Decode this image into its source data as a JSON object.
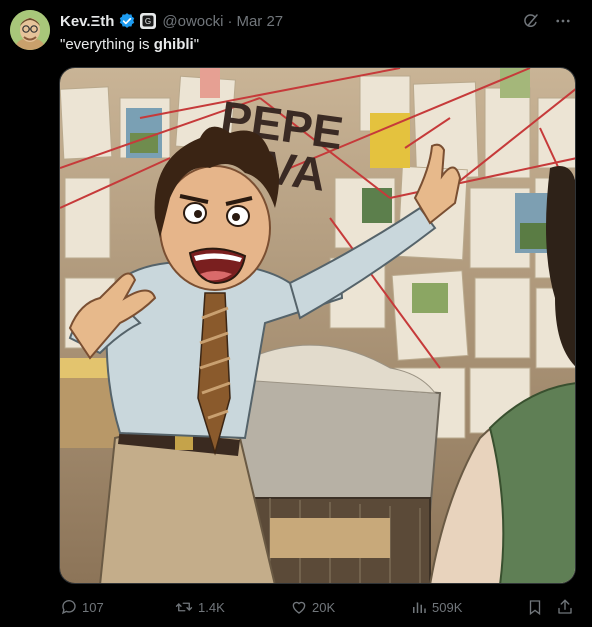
{
  "author": {
    "display_name": "Kev.Ξth",
    "handle": "@owocki",
    "date": "Mar 27",
    "separator": "·"
  },
  "tweet": {
    "text_prefix": "\"everything is ",
    "text_emphasis": "ghibli",
    "text_suffix": "\""
  },
  "image_overlay_text": [
    "PEPE",
    "VA"
  ],
  "actions": {
    "replies": "107",
    "reposts": "1.4K",
    "likes": "20K",
    "views": "509K"
  },
  "icons": [
    "verified-badge-icon",
    "affiliate-badge-icon",
    "grok-icon",
    "more-icon",
    "reply-icon",
    "repost-icon",
    "like-icon",
    "views-icon",
    "bookmark-icon",
    "share-icon"
  ],
  "colors": {
    "background": "#000000",
    "text": "#e7e9ea",
    "muted": "#71767b",
    "verified": "#1d9bf0"
  }
}
